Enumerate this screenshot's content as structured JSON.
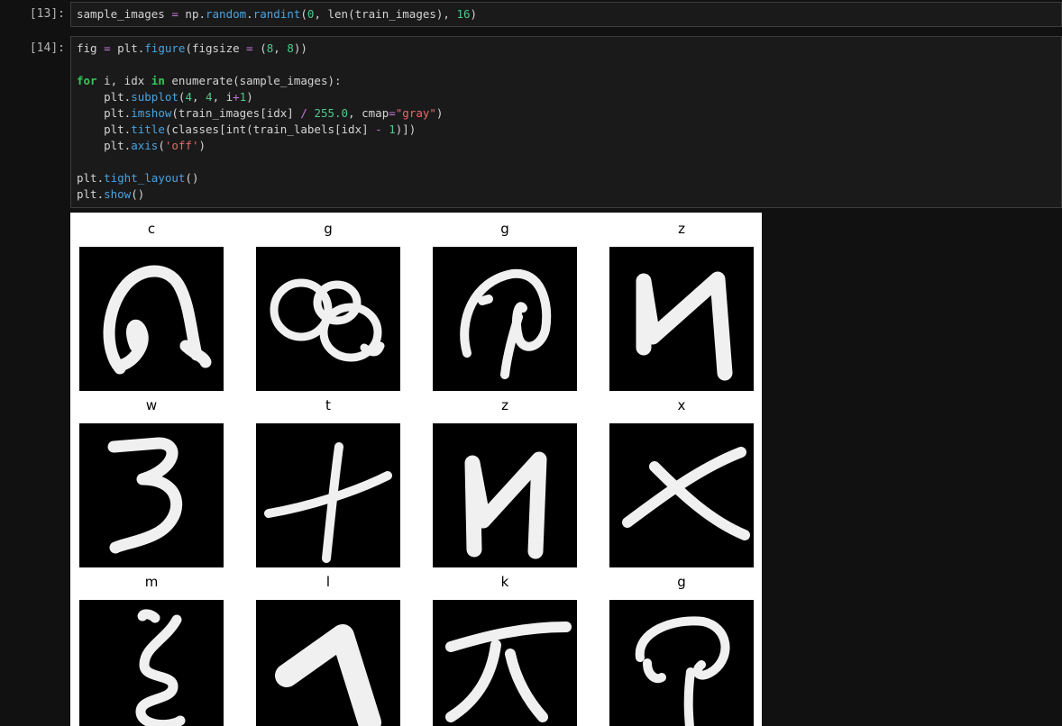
{
  "cells": [
    {
      "prompt": "[13]:",
      "lines": [
        [
          [
            "plain",
            "sample_images "
          ],
          [
            "op",
            "="
          ],
          [
            "plain",
            " np."
          ],
          [
            "attr",
            "random"
          ],
          [
            "plain",
            "."
          ],
          [
            "attr",
            "randint"
          ],
          [
            "plain",
            "("
          ],
          [
            "num",
            "0"
          ],
          [
            "plain",
            ", len(train_images), "
          ],
          [
            "num",
            "16"
          ],
          [
            "plain",
            ")"
          ]
        ]
      ]
    },
    {
      "prompt": "[14]:",
      "lines": [
        [
          [
            "plain",
            "fig "
          ],
          [
            "op",
            "="
          ],
          [
            "plain",
            " plt."
          ],
          [
            "attr",
            "figure"
          ],
          [
            "plain",
            "(figsize "
          ],
          [
            "op",
            "="
          ],
          [
            "plain",
            " ("
          ],
          [
            "num",
            "8"
          ],
          [
            "plain",
            ", "
          ],
          [
            "num",
            "8"
          ],
          [
            "plain",
            "))"
          ]
        ],
        [],
        [
          [
            "kw",
            "for"
          ],
          [
            "plain",
            " i, idx "
          ],
          [
            "kw",
            "in"
          ],
          [
            "plain",
            " enumerate(sample_images):"
          ]
        ],
        [
          [
            "plain",
            "    plt."
          ],
          [
            "attr",
            "subplot"
          ],
          [
            "plain",
            "("
          ],
          [
            "num",
            "4"
          ],
          [
            "plain",
            ", "
          ],
          [
            "num",
            "4"
          ],
          [
            "plain",
            ", i"
          ],
          [
            "op",
            "+"
          ],
          [
            "num",
            "1"
          ],
          [
            "plain",
            ")"
          ]
        ],
        [
          [
            "plain",
            "    plt."
          ],
          [
            "attr",
            "imshow"
          ],
          [
            "plain",
            "(train_images[idx] "
          ],
          [
            "op",
            "/"
          ],
          [
            "plain",
            " "
          ],
          [
            "num",
            "255.0"
          ],
          [
            "plain",
            ", cmap"
          ],
          [
            "op",
            "="
          ],
          [
            "str",
            "\"gray\""
          ],
          [
            "plain",
            ")"
          ]
        ],
        [
          [
            "plain",
            "    plt."
          ],
          [
            "attr",
            "title"
          ],
          [
            "plain",
            "(classes[int(train_labels[idx] "
          ],
          [
            "op",
            "-"
          ],
          [
            "plain",
            " "
          ],
          [
            "num",
            "1"
          ],
          [
            "plain",
            ")])"
          ]
        ],
        [
          [
            "plain",
            "    plt."
          ],
          [
            "attr",
            "axis"
          ],
          [
            "plain",
            "("
          ],
          [
            "str",
            "'off'"
          ],
          [
            "plain",
            ")"
          ]
        ],
        [],
        [
          [
            "plain",
            "plt."
          ],
          [
            "attr",
            "tight_layout"
          ],
          [
            "plain",
            "()"
          ]
        ],
        [
          [
            "plain",
            "plt."
          ],
          [
            "attr",
            "show"
          ],
          [
            "plain",
            "()"
          ]
        ]
      ]
    }
  ],
  "figure": {
    "titles": [
      "c",
      "g",
      "g",
      "z",
      "w",
      "t",
      "z",
      "x",
      "m",
      "l",
      "k",
      "g"
    ],
    "glyph_icons": [
      "handwritten-c-icon",
      "handwritten-g-icon",
      "handwritten-g-icon",
      "handwritten-z-icon",
      "handwritten-w-icon",
      "handwritten-t-icon",
      "handwritten-z-icon",
      "handwritten-x-icon",
      "handwritten-m-icon",
      "handwritten-l-icon",
      "handwritten-k-icon",
      "handwritten-g-icon"
    ]
  },
  "colors": {
    "keyword": "#34c759",
    "operator": "#c678dd",
    "number": "#4ec98e",
    "attribute": "#4aa3df",
    "string": "#e66a6a"
  }
}
